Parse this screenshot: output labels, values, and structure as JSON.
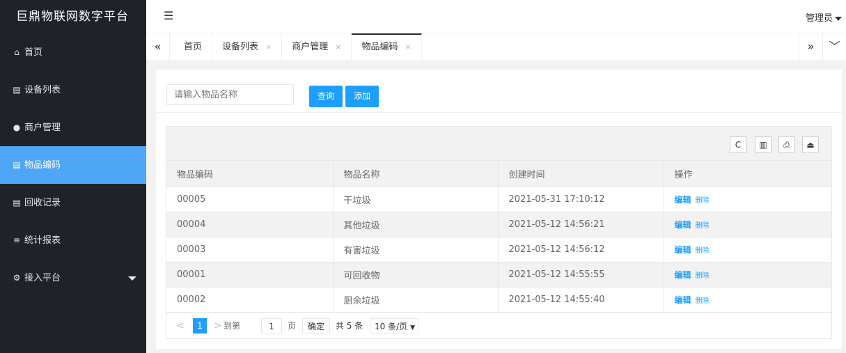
{
  "app": {
    "title": "巨鼎物联网数字平台"
  },
  "sidebar": {
    "items": [
      {
        "label": "首页",
        "icon": "home-icon",
        "glyph": "⌂"
      },
      {
        "label": "设备列表",
        "icon": "list-icon",
        "glyph": "▤"
      },
      {
        "label": "商户管理",
        "icon": "user-icon",
        "glyph": "●"
      },
      {
        "label": "物品编码",
        "icon": "list-icon",
        "glyph": "▤",
        "active": true
      },
      {
        "label": "回收记录",
        "icon": "list-icon",
        "glyph": "▤"
      },
      {
        "label": "统计报表",
        "icon": "menu-icon",
        "glyph": "≡"
      },
      {
        "label": "接入平台",
        "icon": "gear-icon",
        "glyph": "⚙"
      }
    ]
  },
  "header": {
    "fold_glyph": "☰",
    "user": "管理员"
  },
  "tabs": {
    "items": [
      "首页",
      "设备列表",
      "商户管理",
      "物品编码"
    ],
    "close_glyph": "×",
    "left_glyph": "«",
    "right_glyph": "»",
    "down_glyph": "﹀"
  },
  "search": {
    "placeholder": "请输入物品名称",
    "query_label": "查询",
    "add_label": "添加"
  },
  "toolbar": {
    "refresh": "C",
    "columns": "▥",
    "print": "⎙",
    "export": "⏏"
  },
  "table": {
    "columns": [
      "物品编码",
      "物品名称",
      "创建时间",
      "操作"
    ],
    "rows": [
      {
        "code": "00005",
        "name": "干垃圾",
        "time": "2021-05-31 17:10:12"
      },
      {
        "code": "00004",
        "name": "其他垃圾",
        "time": "2021-05-12 14:56:21"
      },
      {
        "code": "00003",
        "name": "有害垃圾",
        "time": "2021-05-12 14:56:12"
      },
      {
        "code": "00001",
        "name": "可回收物",
        "time": "2021-05-12 14:55:55"
      },
      {
        "code": "00002",
        "name": "厨余垃圾",
        "time": "2021-05-12 14:55:40"
      }
    ],
    "edit_label": "编辑",
    "delete_label": "删除"
  },
  "pager": {
    "prev": "<",
    "current": "1",
    "next": ">",
    "goto": "到第",
    "page_input": "1",
    "unit": "页",
    "ok": "确定",
    "total": "共 5 条",
    "size": "10 条/页",
    "size_caret": "▼"
  },
  "colors": {
    "sidebar_bg": "#20222a",
    "active": "#4fa6f7",
    "primary": "#1e9fff"
  }
}
